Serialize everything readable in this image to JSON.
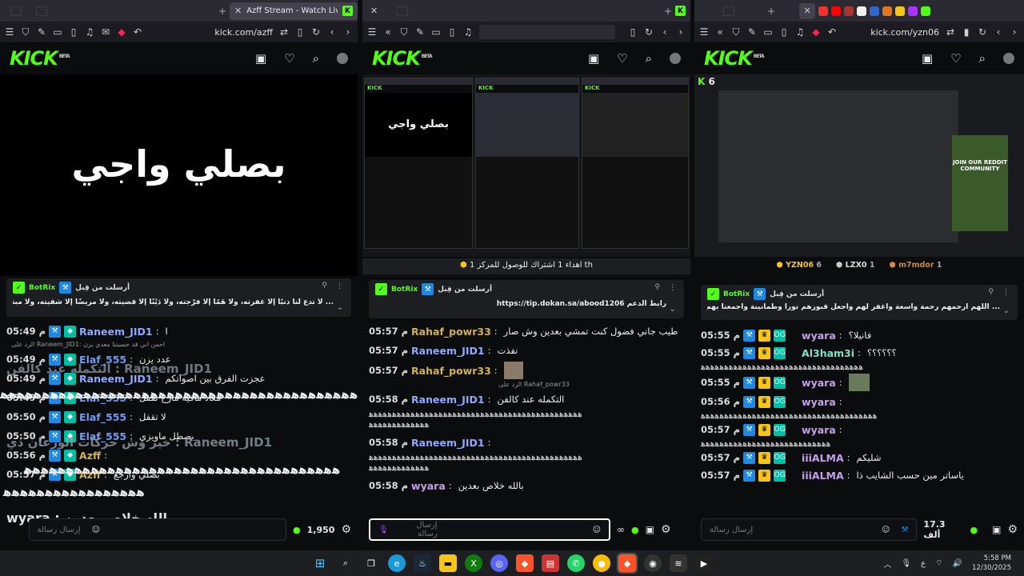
{
  "colors": {
    "kick_green": "#53fc18",
    "bg": "#0b0c0e",
    "tab_bg": "#2b2a33"
  },
  "w1": {
    "tab_title": "Azff Stream - Watch Live on Kick",
    "url": "kick.com/azff",
    "video_text": "بصلي واجي",
    "pinned": {
      "label": "أرسلت من قِبل",
      "by": "BotRix",
      "msg": "... لا تدع لنا ذنبًا إلا غفرته، ولا هَمًا إلا فرّجته، ولا دَيْنًا إلا قضيته، ولا مريضًا إلا شفيته، ولا مبتلى إلا عافيته، يا أكرم الأكرمين"
    },
    "msgs": [
      {
        "time": "05:49",
        "name": "Raneem_JID1",
        "color": "#8ea9ff",
        "text": "ا"
      },
      {
        "time": "05:49",
        "name": "Elaf_555",
        "color": "#6f9cf2",
        "text": "عدد يزن"
      },
      {
        "time": "05:49",
        "name": "Raneem_JID1",
        "color": "#8ea9ff",
        "text": "عجزت الفرق بين اصواتكم"
      },
      {
        "time": "05:49",
        "name": "Elaf_555",
        "color": "#6f9cf2",
        "text": "معاد مافيه مارح نقفل"
      },
      {
        "time": "05:50",
        "name": "Elaf_555",
        "color": "#6f9cf2",
        "text": "لا تقفل"
      },
      {
        "time": "05:50",
        "name": "Elaf_555",
        "color": "#6f9cf2",
        "text": "بصطل ماويزي"
      },
      {
        "time": "05:56",
        "name": "Azff",
        "color": "#d4b24c",
        "text": ""
      },
      {
        "time": "05:57",
        "name": "Azff",
        "color": "#d4b24c",
        "text": "بصلي وارجع"
      }
    ],
    "reply": "الرد على Raneem_JID1: احس اني قد حسبتنا معدي يزن",
    "ghost1": "التكمله عند كالفن : Raneem_JID1",
    "ghost2": "خير وش حركات الورعان ذي : Raneem_JID1",
    "ghost3": "wyara : بالله خلاص بعدين",
    "placeholder": "إرسال رسالة",
    "points": "1,950"
  },
  "w2": {
    "url": "",
    "banner": "اهداء 1 اشتراك للوصول للمركز 1 th",
    "pinned": {
      "label": "أرسلت من قِبل",
      "by": "BotRix",
      "msg": "رابط الدعم https://tip.dokan.sa/abood1206"
    },
    "msgs": [
      {
        "time": "05:57",
        "name": "Rahaf_powr33",
        "color": "#d4b24c",
        "text": "طيب جاني فضول كنت تمشي بعدين وش صار"
      },
      {
        "time": "05:57",
        "name": "Raneem_JID1",
        "color": "#8ea9ff",
        "text": "نفذت"
      },
      {
        "time": "05:57",
        "name": "Rahaf_powr33",
        "color": "#d4b24c",
        "text": ""
      },
      {
        "time": "05:58",
        "name": "Raneem_JID1",
        "color": "#8ea9ff",
        "text": "التكمله عند كالفن"
      },
      {
        "time": "05:58",
        "name": "Raneem_JID1",
        "color": "#8ea9ff",
        "text": ""
      },
      {
        "time": "05:58",
        "name": "wyara",
        "color": "#c6a0e8",
        "text": "بالله خلاص بعدين"
      }
    ],
    "reply": "الرد على Rahaf_powr33",
    "long1": "ﻫﻫﻫﻫﻫﻫﻫﻫﻫﻫﻫﻫﻫﻫﻫﻫﻫﻫﻫﻫﻫﻫﻫﻫﻫﻫﻫﻫﻫﻫﻫﻫﻫﻫﻫﻫﻫﻫﻫﻫﻫﻫﻫﻫﻫﻫ",
    "long2": "ﻫﻫﻫﻫﻫﻫﻫﻫﻫﻫﻫﻫﻫ",
    "placeholder": "إرسال رسالة"
  },
  "w3": {
    "url": "kick.com/yzn06",
    "viewers": "6",
    "leaders": [
      {
        "name": "YZN06",
        "n": "6"
      },
      {
        "name": "LZX0",
        "n": "1"
      },
      {
        "name": "m7mdor",
        "n": "1"
      }
    ],
    "pinned": {
      "label": "أرسلت من قِبل",
      "by": "BotRix",
      "msg": "... اللهم ارحمهم رحمة واسعة واغفر لهم واجعل قبورهم نورا وطمأنينة واجمعنا بهم في جناتك بلا حساب ولا عقاب"
    },
    "msgs": [
      {
        "time": "05:55",
        "name": "wyara",
        "color": "#c6a0e8",
        "text": "فانيلا؟"
      },
      {
        "time": "05:55",
        "name": "Al3ham3i",
        "color": "#7fe3c6",
        "text": "؟؟؟؟؟؟"
      },
      {
        "time": "05:55",
        "name": "wyara",
        "color": "#c6a0e8",
        "text": ""
      },
      {
        "time": "05:56",
        "name": "wyara",
        "color": "#c6a0e8",
        "text": ""
      },
      {
        "time": "05:57",
        "name": "wyara",
        "color": "#c6a0e8",
        "text": ""
      },
      {
        "time": "05:57",
        "name": "iiiALMA",
        "color": "#c6a0e8",
        "text": "شليكم"
      },
      {
        "time": "05:57",
        "name": "iiiALMA",
        "color": "#c6a0e8",
        "text": "ياساتر مين حسب الشايب ذا"
      }
    ],
    "long1": "ﻫﻫﻫﻫﻫﻫﻫﻫﻫﻫﻫﻫﻫﻫﻫﻫﻫﻫﻫﻫﻫﻫﻫﻫﻫﻫﻫﻫﻫﻫﻫﻫﻫﻫﻫ",
    "long2": "ﻫﻫﻫﻫﻫﻫﻫﻫﻫﻫﻫﻫﻫﻫﻫﻫﻫﻫﻫﻫﻫﻫﻫﻫﻫﻫﻫﻫﻫﻫﻫﻫﻫﻫﻫﻫﻫﻫ",
    "long3": "ﻫﻫﻫﻫﻫﻫﻫﻫﻫﻫﻫﻫﻫﻫﻫﻫﻫﻫﻫﻫﻫﻫﻫﻫﻫﻫﻫﻫ",
    "placeholder": "إرسال رسالة",
    "points": "17.3 ألف",
    "reddit": "JOIN OUR REDDIT COMMUNITY"
  },
  "am": "م",
  "clock": {
    "time": "5:58 PM",
    "date": "12/30/2025"
  },
  "tray": {
    "lang": "ع"
  }
}
